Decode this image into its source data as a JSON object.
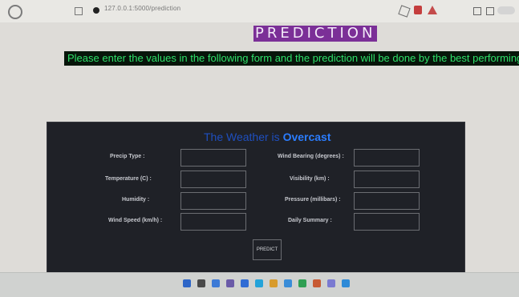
{
  "browser": {
    "url": "127.0.0.1:5000/prediction"
  },
  "page": {
    "title": "PREDICTION",
    "banner": "Please enter the values in the following form and the prediction will be done by the best performing model"
  },
  "result": {
    "heading_prefix": "The Weather is",
    "heading_value": "Overcast"
  },
  "form": {
    "left_fields": [
      {
        "label": "Precip Type :"
      },
      {
        "label": "Temperature (C) :"
      },
      {
        "label": "Humidity :"
      },
      {
        "label": "Wind Speed (km/h) :"
      }
    ],
    "right_fields": [
      {
        "label": "Wind Bearing (degrees) :"
      },
      {
        "label": "Visibility (km) :"
      },
      {
        "label": "Pressure (millibars) :"
      },
      {
        "label": "Daily Summary :"
      }
    ],
    "submit_label": "PREDICT"
  }
}
